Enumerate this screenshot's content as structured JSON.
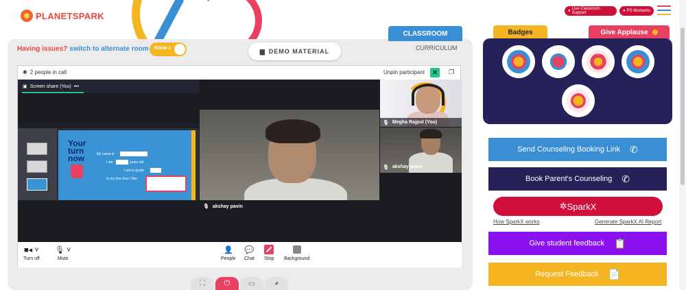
{
  "brand": {
    "logo_text": "PLANETSPARK"
  },
  "top_right": {
    "live_support": "Live Classroom Support",
    "ps_moments": "PS Moments"
  },
  "classroom": {
    "tab_classroom": "CLASSROOM",
    "tab_curriculum": "CURRICULUM",
    "issue_prefix": "Having issues?",
    "issue_link": "switch to alternate room",
    "room_label": "ROOM 2",
    "demo_material": "DEMO MATERIAL"
  },
  "meeting": {
    "people_count": "2 people in call",
    "unpin": "Unpin participant",
    "screen_share_label": "Screen share (You)",
    "main_participant": "akshay pavin",
    "participants": [
      {
        "name": "Megha Rajput (You)"
      },
      {
        "name": "akshay pavin"
      }
    ],
    "slide": {
      "heading_line1": "Your",
      "heading_line2": "turn",
      "heading_line3": "now",
      "field1": "My name is",
      "field2": "I am",
      "field2b": "years old",
      "field3": "I am in grade",
      "field4": "In my free time I like"
    },
    "controls": {
      "turn_off": "Turn off",
      "mute": "Mute",
      "people": "People",
      "chat": "Chat",
      "stop": "Stop",
      "background": "Background"
    }
  },
  "badges": {
    "tab_badges": "Badges",
    "tab_applause": "Give Applause",
    "items": [
      {
        "icon": "trophy-badge-icon"
      },
      {
        "icon": "hand-raise-badge-icon"
      },
      {
        "icon": "meditation-badge-icon"
      },
      {
        "icon": "idea-badge-icon"
      },
      {
        "icon": "brain-badge-icon"
      }
    ]
  },
  "actions": {
    "send_counseling": "Send Counseling Booking Link",
    "book_parent": "Book Parent's Counseling",
    "sparkx": "SparkX",
    "how_sparkx": "How SparkX works",
    "generate_report": "Generate SparkX AI Report",
    "student_feedback": "Give student feedback",
    "request_feedback": "Request Feedback"
  },
  "colors": {
    "brand_red": "#e84060",
    "brand_blue": "#3a8fd4",
    "brand_yellow": "#f5b522",
    "navy": "#262259",
    "purple": "#8a12f0",
    "green": "#22c785"
  }
}
